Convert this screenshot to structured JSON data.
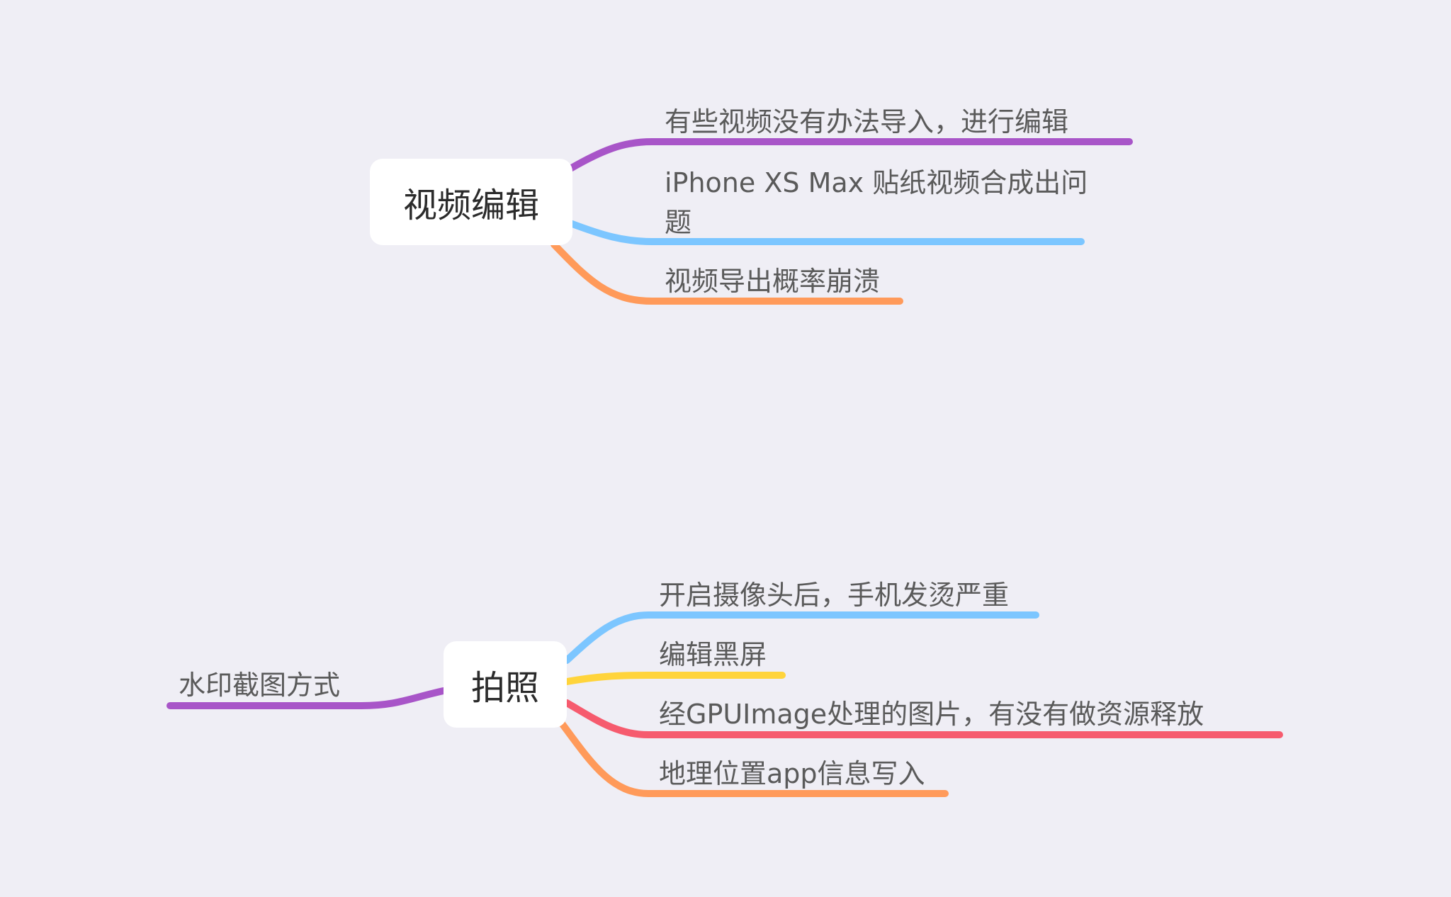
{
  "diagram": {
    "groups": [
      {
        "id": "video",
        "topic": "视频编辑",
        "branches": [
          {
            "label": "有些视频没有办法导入，进行编辑",
            "color": "#a855c8"
          },
          {
            "label": "iPhone XS Max 贴纸视频合成出问题",
            "color": "#7cc6ff"
          },
          {
            "label": "视频导出概率崩溃",
            "color": "#ff9a5a"
          }
        ]
      },
      {
        "id": "photo",
        "topic": "拍照",
        "left_branches": [
          {
            "label": "水印截图方式",
            "color": "#a855c8"
          }
        ],
        "branches": [
          {
            "label": "开启摄像头后，手机发烫严重",
            "color": "#7cc6ff"
          },
          {
            "label": "编辑黑屏",
            "color": "#ffd43b"
          },
          {
            "label": "经GPUImage处理的图片，有没有做资源释放",
            "color": "#f65b6e"
          },
          {
            "label": "地理位置app信息写入",
            "color": "#ff9a5a"
          }
        ]
      }
    ]
  }
}
